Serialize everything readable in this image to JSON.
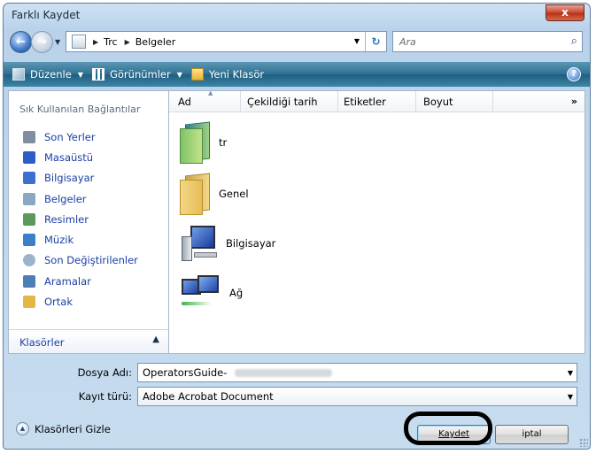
{
  "window": {
    "title": "Farklı Kaydet",
    "close_label": "x"
  },
  "address": {
    "breadcrumbs": [
      "Trc",
      "Belgeler"
    ],
    "search_placeholder": "Ara"
  },
  "toolbar": {
    "organize": "Düzenle",
    "views": "Görünümler",
    "new_folder": "Yeni Klasör",
    "help": "?"
  },
  "sidebar": {
    "header": "Sık Kullanılan Bağlantılar",
    "items": [
      {
        "label": "Son Yerler",
        "icon": "recent-places-icon",
        "color": "#7f8ea0"
      },
      {
        "label": "Masaüstü",
        "icon": "desktop-icon",
        "color": "#2b5fc5"
      },
      {
        "label": "Bilgisayar",
        "icon": "computer-icon",
        "color": "#3b6fd0"
      },
      {
        "label": "Belgeler",
        "icon": "documents-icon",
        "color": "#8aa7c4"
      },
      {
        "label": "Resimler",
        "icon": "pictures-icon",
        "color": "#5b9a5c"
      },
      {
        "label": "Müzik",
        "icon": "music-icon",
        "color": "#3a7fc8"
      },
      {
        "label": "Son Değiştirilenler",
        "icon": "recently-changed-icon",
        "color": "#9db3cc"
      },
      {
        "label": "Aramalar",
        "icon": "searches-icon",
        "color": "#4b7fb5"
      },
      {
        "label": "Ortak",
        "icon": "public-folder-icon",
        "color": "#e3b645"
      }
    ],
    "folders_label": "Klasörler"
  },
  "columns": [
    "Ad",
    "Çekildiği tarih",
    "Etiketler",
    "Boyut"
  ],
  "files": [
    {
      "name": "tr",
      "icon": "folder-icon"
    },
    {
      "name": "Genel",
      "icon": "folder-icon"
    },
    {
      "name": "Bilgisayar",
      "icon": "computer-icon"
    },
    {
      "name": "Ağ",
      "icon": "network-icon"
    }
  ],
  "form": {
    "filename_label": "Dosya Adı:",
    "filename_value": "OperatorsGuide-",
    "filetype_label": "Kayıt türü:",
    "filetype_value": "Adobe Acrobat Document"
  },
  "footer": {
    "hide_folders": "Klasörleri Gizle",
    "save": "Kaydet",
    "cancel": "iptal"
  }
}
